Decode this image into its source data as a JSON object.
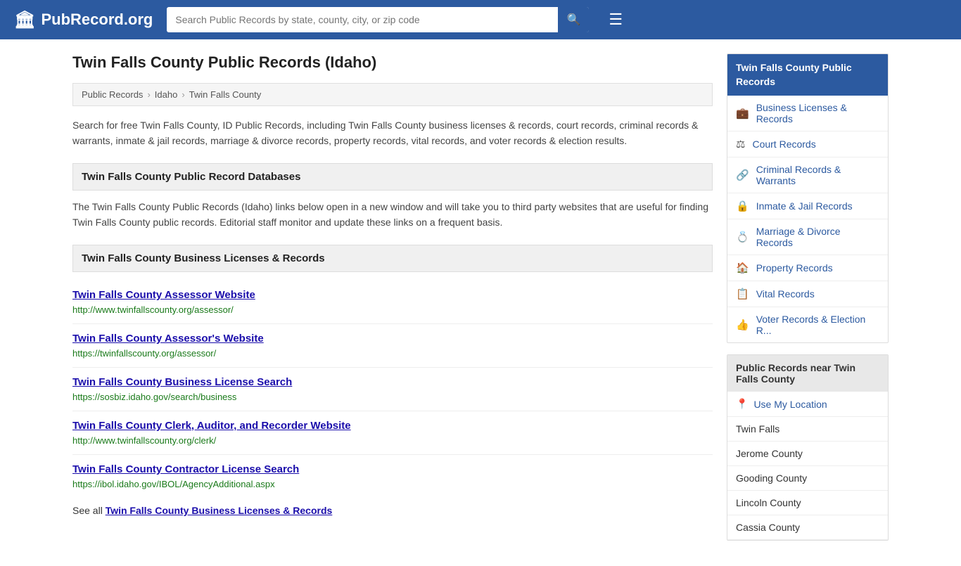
{
  "header": {
    "logo_icon": "🏛",
    "logo_text": "PubRecord.org",
    "search_placeholder": "Search Public Records by state, county, city, or zip code",
    "search_icon": "🔍",
    "menu_icon": "☰"
  },
  "page": {
    "title": "Twin Falls County Public Records (Idaho)",
    "breadcrumbs": [
      {
        "label": "Public Records",
        "href": "#"
      },
      {
        "label": "Idaho",
        "href": "#"
      },
      {
        "label": "Twin Falls County",
        "href": "#"
      }
    ],
    "description": "Search for free Twin Falls County, ID Public Records, including Twin Falls County business licenses & records, court records, criminal records & warrants, inmate & jail records, marriage & divorce records, property records, vital records, and voter records & election results.",
    "databases_header": "Twin Falls County Public Record Databases",
    "databases_text": "The Twin Falls County Public Records (Idaho) links below open in a new window and will take you to third party websites that are useful for finding Twin Falls County public records. Editorial staff monitor and update these links on a frequent basis.",
    "business_header": "Twin Falls County Business Licenses & Records",
    "records": [
      {
        "title": "Twin Falls County Assessor Website",
        "url": "http://www.twinfallscounty.org/assessor/"
      },
      {
        "title": "Twin Falls County Assessor's Website",
        "url": "https://twinfallscounty.org/assessor/"
      },
      {
        "title": "Twin Falls County Business License Search",
        "url": "https://sosbiz.idaho.gov/search/business"
      },
      {
        "title": "Twin Falls County Clerk, Auditor, and Recorder Website",
        "url": "http://www.twinfallscounty.org/clerk/"
      },
      {
        "title": "Twin Falls County Contractor License Search",
        "url": "https://ibol.idaho.gov/IBOL/AgencyAdditional.aspx"
      }
    ],
    "see_all_text": "See all",
    "see_all_link": "Twin Falls County Business Licenses & Records"
  },
  "sidebar": {
    "box_title": "Twin Falls County Public Records",
    "items": [
      {
        "label": "Business Licenses & Records",
        "icon": "💼"
      },
      {
        "label": "Court Records",
        "icon": "⚖"
      },
      {
        "label": "Criminal Records & Warrants",
        "icon": "🔗"
      },
      {
        "label": "Inmate & Jail Records",
        "icon": "🔒"
      },
      {
        "label": "Marriage & Divorce Records",
        "icon": "💍"
      },
      {
        "label": "Property Records",
        "icon": "🏠"
      },
      {
        "label": "Vital Records",
        "icon": "📋"
      },
      {
        "label": "Voter Records & Election R...",
        "icon": "👍"
      }
    ],
    "nearby_title": "Public Records near Twin Falls County",
    "nearby_items": [
      {
        "label": "Use My Location",
        "icon": "📍",
        "is_location": true
      },
      {
        "label": "Twin Falls",
        "icon": ""
      },
      {
        "label": "Jerome County",
        "icon": ""
      },
      {
        "label": "Gooding County",
        "icon": ""
      },
      {
        "label": "Lincoln County",
        "icon": ""
      },
      {
        "label": "Cassia County",
        "icon": ""
      }
    ]
  }
}
